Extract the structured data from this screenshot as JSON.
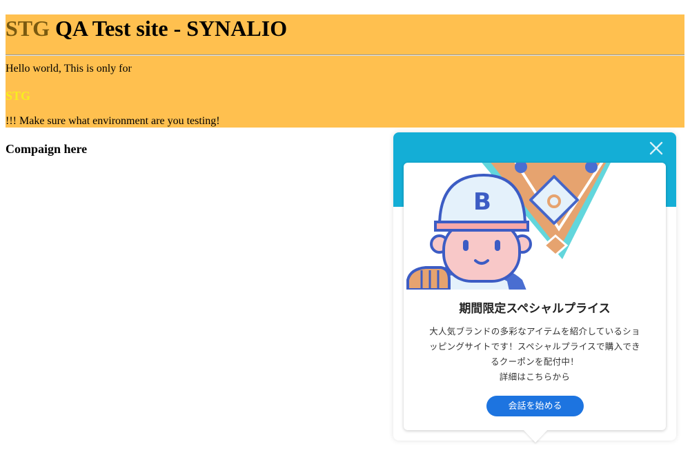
{
  "banner": {
    "title_prefix": "STG",
    "title_rest": " QA Test site - SYNALIO",
    "hello_text": "Hello world, This is only for",
    "stg_label": "STG",
    "warning_text": "!!! Make sure what environment are you testing!",
    "background_color": "#ffc04f"
  },
  "campaign": {
    "heading": "Compaign here"
  },
  "chat_widget": {
    "close_icon": "close-icon",
    "header_color": "#14aed6",
    "illustration": {
      "cap_letter": "B",
      "subject": "baseball-player"
    },
    "title": "期間限定スペシャルプライス",
    "body_lines": [
      "大人気ブランドの多彩なアイテムを紹介しているショ",
      "ッピングサイトです！スペシャルプライスで購入でき",
      "るクーポンを配付中！",
      "詳細はこちらから"
    ],
    "cta_label": "会話を始める",
    "cta_color": "#1d74e0"
  }
}
